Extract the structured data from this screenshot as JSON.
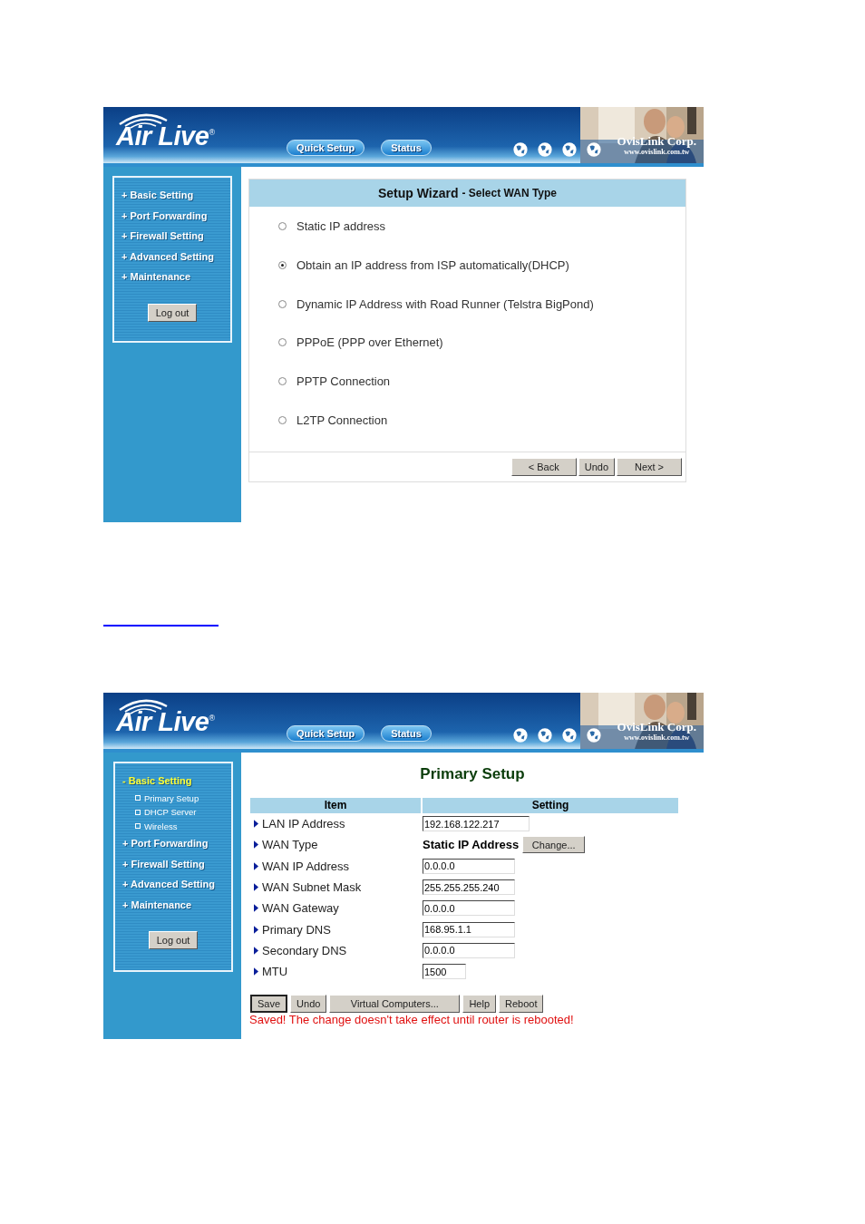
{
  "screens": [
    {
      "kind": "wizard",
      "header": {
        "logo": "Air Live",
        "logo_mark": "®",
        "nav": [
          {
            "label": "Quick Setup"
          },
          {
            "label": "Status"
          }
        ],
        "company": "OvisLink Corp.",
        "website": "www.ovislink.com.tw"
      },
      "sidebar": {
        "items": [
          {
            "label": "+ Basic Setting",
            "expanded": false
          },
          {
            "label": "+ Port Forwarding",
            "expanded": false
          },
          {
            "label": "+ Firewall Setting",
            "expanded": false
          },
          {
            "label": "+ Advanced Setting",
            "expanded": false
          },
          {
            "label": "+ Maintenance",
            "expanded": false
          }
        ],
        "logout": "Log out"
      },
      "content": {
        "title": "Setup Wizard",
        "subtitle": "- Select WAN Type",
        "options": [
          {
            "label": "Static IP address",
            "selected": false
          },
          {
            "label": "Obtain an IP address from ISP automatically(DHCP)",
            "selected": true
          },
          {
            "label": "Dynamic IP Address with Road Runner (Telstra BigPond)",
            "selected": false
          },
          {
            "label": "PPPoE (PPP over Ethernet)",
            "selected": false
          },
          {
            "label": "PPTP Connection",
            "selected": false
          },
          {
            "label": "L2TP Connection",
            "selected": false
          }
        ],
        "buttons": [
          "< Back",
          "Undo",
          "Next >"
        ]
      }
    },
    {
      "kind": "primary",
      "header": {
        "logo": "Air Live",
        "logo_mark": "®",
        "nav": [
          {
            "label": "Quick Setup"
          },
          {
            "label": "Status"
          }
        ],
        "company": "OvisLink Corp.",
        "website": "www.ovislink.com.tw"
      },
      "sidebar": {
        "items": [
          {
            "label": "- Basic Setting",
            "expanded": true,
            "children": [
              {
                "label": "Primary Setup"
              },
              {
                "label": "DHCP Server"
              },
              {
                "label": "Wireless"
              }
            ]
          },
          {
            "label": "+ Port Forwarding",
            "expanded": false
          },
          {
            "label": "+ Firewall Setting",
            "expanded": false
          },
          {
            "label": "+ Advanced Setting",
            "expanded": false
          },
          {
            "label": "+ Maintenance",
            "expanded": false
          }
        ],
        "logout": "Log out"
      },
      "content": {
        "title": "Primary Setup",
        "columns": [
          "Item",
          "Setting"
        ],
        "rows": [
          {
            "label": "LAN IP Address",
            "kind": "wide-field",
            "value": "192.168.122.217"
          },
          {
            "label": "WAN Type",
            "kind": "choice",
            "value": "Static IP Address",
            "button": "Change..."
          },
          {
            "label": "WAN IP Address",
            "kind": "field",
            "value": "0.0.0.0"
          },
          {
            "label": "WAN Subnet Mask",
            "kind": "field",
            "value": "255.255.255.240"
          },
          {
            "label": "WAN Gateway",
            "kind": "field",
            "value": "0.0.0.0"
          },
          {
            "label": "Primary DNS",
            "kind": "field",
            "value": "168.95.1.1"
          },
          {
            "label": "Secondary DNS",
            "kind": "field",
            "value": "0.0.0.0"
          },
          {
            "label": "MTU",
            "kind": "short-field",
            "value": "1500"
          }
        ],
        "buttons": [
          {
            "label": "Save",
            "pressed": true
          },
          {
            "label": "Undo",
            "pressed": false
          },
          {
            "label": "Virtual Computers...",
            "pressed": false
          },
          {
            "label": "Help",
            "pressed": false
          },
          {
            "label": "Reboot",
            "pressed": false
          }
        ],
        "message": "Saved! The change doesn't take effect until router is rebooted!"
      }
    }
  ]
}
